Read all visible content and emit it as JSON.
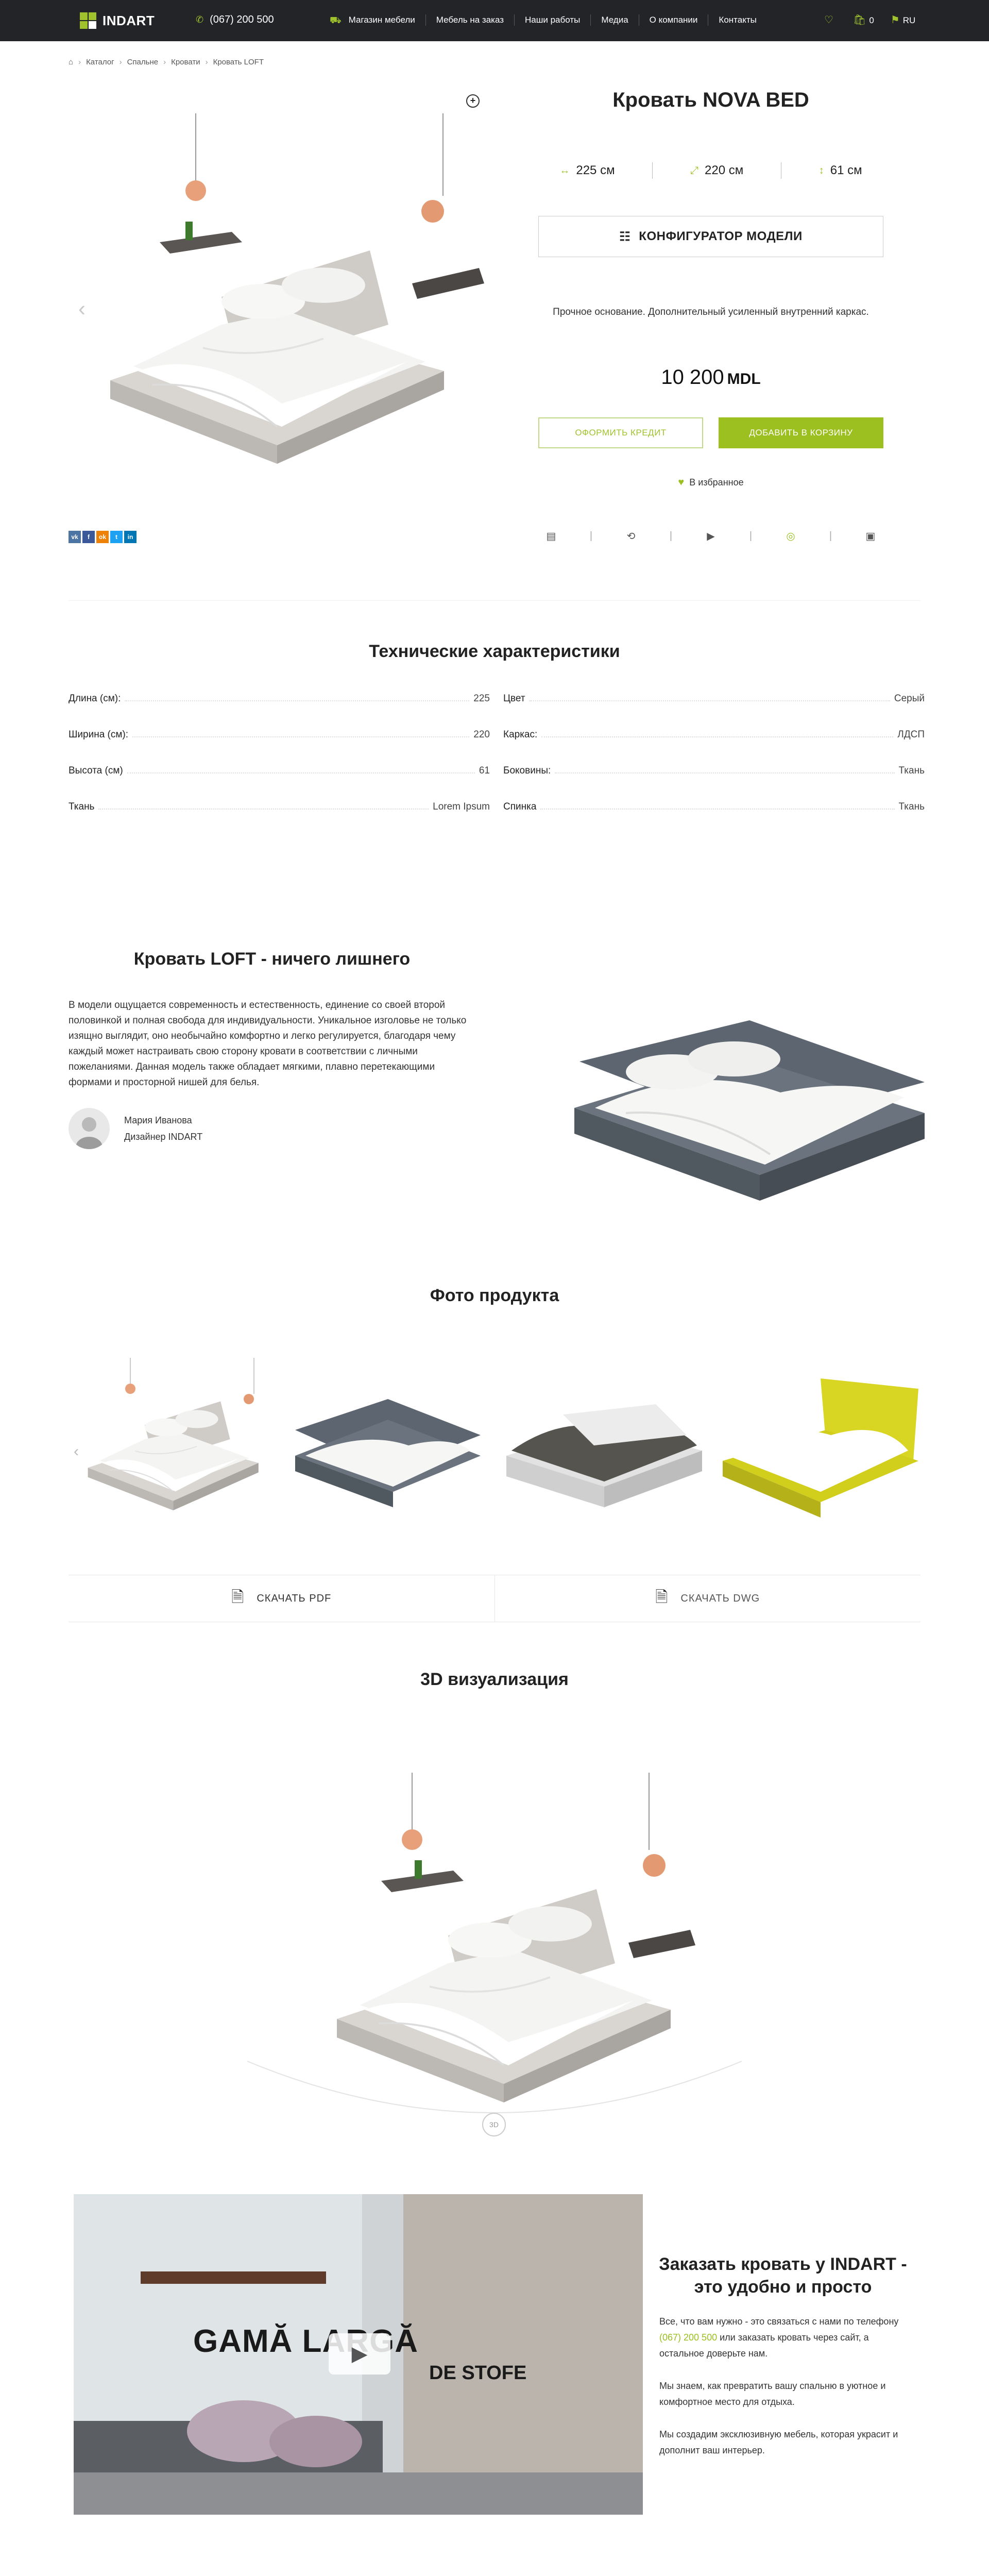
{
  "header": {
    "logo": "INDART",
    "phone": "(067) 200 500",
    "nav": [
      "Магазин мебели",
      "Мебель на заказ",
      "Наши работы",
      "Медиа",
      "О компании",
      "Контакты"
    ],
    "cart_count": "0",
    "lang": "RU",
    "colors": {
      "bg": "#222428",
      "accent": "#a0c32d"
    }
  },
  "breadcrumb": [
    "Каталог",
    "Спальне",
    "Кровати",
    "Кровать LOFT"
  ],
  "product": {
    "title": "Кровать  NOVA BED",
    "dims": [
      "225 см",
      "220 см",
      "61 см"
    ],
    "config_label": "КОНФИГУРАТОР МОДЕЛИ",
    "description": "Прочное основание. Дополнительный усиленный внутренний каркас.",
    "price": "10 200",
    "currency": "MDL",
    "credit_label": "ОФОРМИТЬ КРЕДИТ",
    "cart_label": "ДОБАВИТЬ В КОРЗИНУ",
    "fav_label": "В избранное"
  },
  "share": [
    "vk",
    "f",
    "ok",
    "tw",
    "in"
  ],
  "specs": {
    "title": "Технические характеристики",
    "left": [
      {
        "k": "Длина (см):",
        "v": "225"
      },
      {
        "k": "Ширина (см):",
        "v": "220"
      },
      {
        "k": "Высота (см)",
        "v": "61"
      },
      {
        "k": "Ткань",
        "v": "Lorem Ipsum"
      }
    ],
    "right": [
      {
        "k": "Цвет",
        "v": "Серый"
      },
      {
        "k": "Каркас:",
        "v": "ЛДСП"
      },
      {
        "k": "Боковины:",
        "v": "Ткань"
      },
      {
        "k": "Спинка",
        "v": "Ткань"
      }
    ]
  },
  "loft": {
    "title": "Кровать LOFT - ничего лишнего",
    "text": "В модели ощущается современность и естественность, единение со своей второй половинкой и полная свобода для индивидуальности. Уникальное изголовье не только изящно выглядит, оно необычайно комфортно и легко регулируется, благодаря чему каждый может настраивать свою сторону кровати в соответствии с личными пожеланиями. Данная модель также обладает мягкими, плавно перетекающими формами и просторной нишей для белья.",
    "author_name": "Мария Иванова",
    "author_role": "Дизайнер INDART"
  },
  "photos": {
    "title": "Фото продукта",
    "download_pdf": "СКАЧАТЬ PDF",
    "download_dwg": "СКАЧАТЬ DWG"
  },
  "viz": {
    "title": "3D визуализация",
    "badge": "3D"
  },
  "video": {
    "line1": "GAMĂ LARGĂ",
    "line2": "DE STOFE"
  },
  "order": {
    "title": "Заказать кровать у INDART - это удобно и просто",
    "p1_before": "Все, что вам нужно - это связаться с нами по телефону ",
    "p1_phone": "(067) 200 500",
    "p1_after": " или заказать кровать через сайт, а остальное доверьте нам.",
    "p2": "Мы знаем, как превратить вашу спальню в уютное и комфортное место для отдыха.",
    "p3": "Мы создадим эксклюзивную мебель, которая украсит и дополнит ваш интерьер."
  }
}
